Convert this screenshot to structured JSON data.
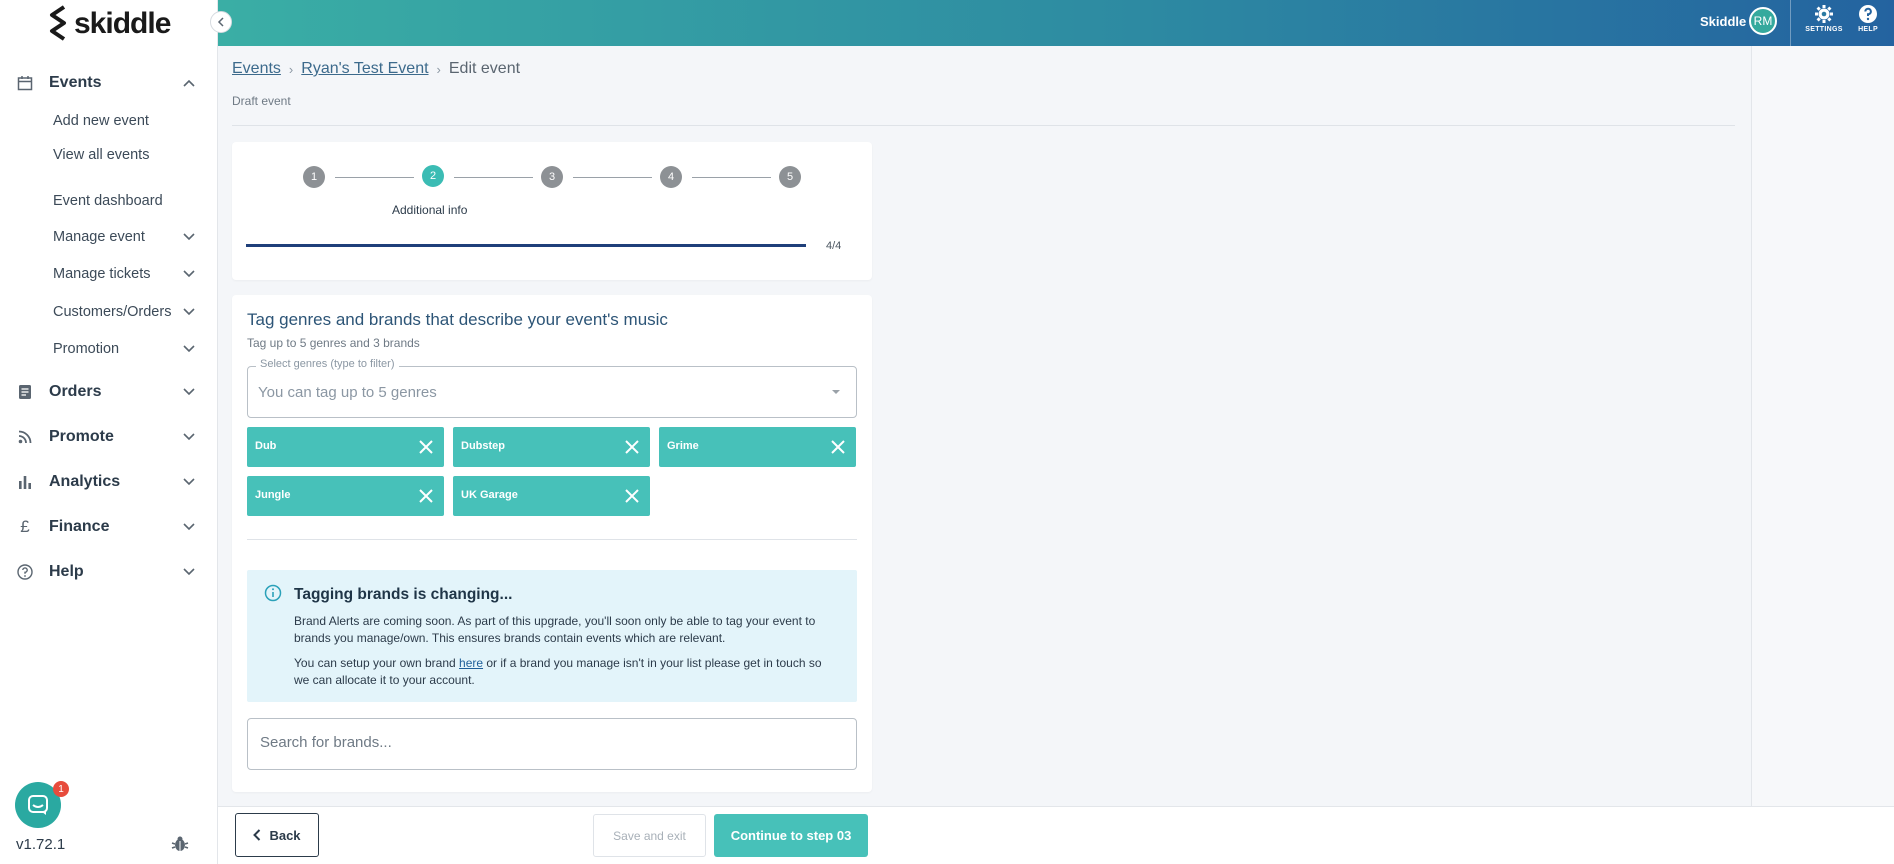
{
  "brand": {
    "name": "skiddle"
  },
  "sidebar": {
    "sections": [
      {
        "label": "Events",
        "icon": "calendar-icon",
        "expanded": true
      },
      {
        "label": "Orders",
        "icon": "document-icon"
      },
      {
        "label": "Promote",
        "icon": "rss-icon"
      },
      {
        "label": "Analytics",
        "icon": "bar-chart-icon"
      },
      {
        "label": "Finance",
        "icon": "pound-icon"
      },
      {
        "label": "Help",
        "icon": "question-icon"
      }
    ],
    "event_items": [
      {
        "label": "Add new event"
      },
      {
        "label": "View all events"
      },
      {
        "label": "Event dashboard"
      },
      {
        "label": "Manage event"
      },
      {
        "label": "Manage tickets"
      },
      {
        "label": "Customers/Orders"
      },
      {
        "label": "Promotion"
      }
    ],
    "chat_badge": "1",
    "version": "v1.72.1"
  },
  "topbar": {
    "user_name": "Skiddle",
    "avatar_initials": "RM",
    "settings_label": "SETTINGS",
    "help_label": "HELP"
  },
  "breadcrumb": {
    "items": [
      "Events",
      "Ryan's Test Event"
    ],
    "current": "Edit event",
    "separator": "›"
  },
  "status_text": "Draft event",
  "stepper": {
    "steps": [
      "1",
      "2",
      "3",
      "4",
      "5"
    ],
    "active_step": 2,
    "active_label": "Additional info",
    "progress_text": "4/4",
    "progress_fraction": 1.0
  },
  "genres": {
    "title": "Tag genres and brands that describe your event's music",
    "subtitle": "Tag up to 5 genres and 3 brands",
    "select_label": "Select genres (type to filter)",
    "placeholder": "You can tag up to 5 genres",
    "tags": [
      "Dub",
      "Dubstep",
      "Grime",
      "Jungle",
      "UK Garage"
    ]
  },
  "brands_notice": {
    "title": "Tagging brands is changing...",
    "p1": "Brand Alerts are coming soon. As part of this upgrade, you'll soon only be able to tag your event to brands you manage/own. This ensures brands contain events which are relevant.",
    "p2_before": "You can setup your own brand ",
    "p2_link": "here",
    "p2_after": " or if a brand you manage isn't in your list please get in touch so we can allocate it to your account."
  },
  "brand_search": {
    "placeholder": "Search for brands..."
  },
  "footer": {
    "back_label": "Back",
    "save_label": "Save and exit",
    "continue_label": "Continue to step 03"
  },
  "colors": {
    "accent": "#47c1b9",
    "progress": "#1f3f7a",
    "info_bg": "#e3f4fa"
  }
}
